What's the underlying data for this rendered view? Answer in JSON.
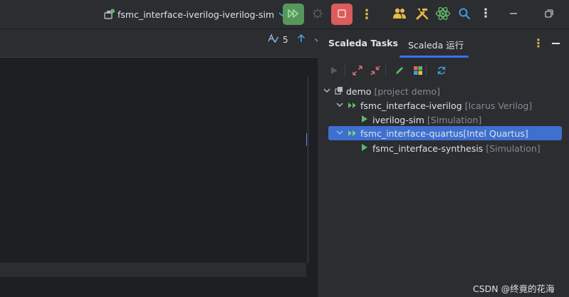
{
  "toolbar": {
    "run_configuration": "fsmc_interface-iverilog-iverilog-sim",
    "run_button_color": "#57965c",
    "stop_button_color": "#db5c5c",
    "icons": [
      "run-config-icon",
      "chevron-down-icon",
      "run-icon",
      "debug-icon",
      "stop-icon",
      "more-vertical-icon",
      "users-icon",
      "tools-icon",
      "atom-icon",
      "search-icon",
      "kebab-icon",
      "minimize-icon",
      "restore-icon"
    ]
  },
  "editor": {
    "inspection_count": "5",
    "icons": [
      "spellcheck-icon",
      "arrow-up-icon",
      "arrow-down-icon"
    ]
  },
  "tool_window": {
    "tabs": [
      {
        "label": "Scaleda Tasks",
        "active": false
      },
      {
        "label": "Scaleda 运行",
        "active": true
      }
    ],
    "accent_color": "#3574f0",
    "toolbar_icons": [
      "run-icon",
      "expand-all-icon",
      "collapse-all-icon",
      "edit-icon",
      "grid-icon",
      "refresh-icon"
    ],
    "tree": [
      {
        "label": "demo",
        "hint": "[project demo]"
      },
      {
        "label": "fsmc_interface-iverilog",
        "hint": "[Icarus Verilog]"
      },
      {
        "label": "iverilog-sim",
        "hint": "[Simulation]"
      },
      {
        "label": "fsmc_interface-quartus",
        "hint": "[Intel Quartus]",
        "selected": true
      },
      {
        "label": "fsmc_interface-synthesis",
        "hint": "[Simulation]"
      }
    ]
  },
  "watermark": "CSDN @终竟的花海"
}
